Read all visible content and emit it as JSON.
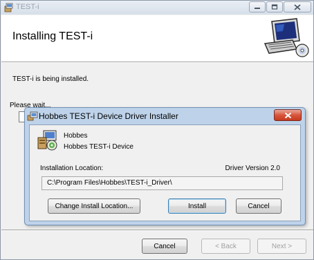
{
  "outer_window": {
    "title": "TEST-i",
    "heading": "Installing TEST-i",
    "status_text": "TEST-i is being installed.",
    "wait_text": "Please wait...",
    "buttons": {
      "cancel": "Cancel",
      "back": "< Back",
      "next": "Next >"
    },
    "icons": [
      "installer-icon",
      "minimize-icon",
      "maximize-icon",
      "close-icon",
      "computer-cd-icon"
    ]
  },
  "dialog": {
    "title": "Hobbes TEST-i Device Driver Installer",
    "company": "Hobbes",
    "product": "Hobbes TEST-i Device",
    "location_label": "Installation Location:",
    "driver_version": "Driver Version 2.0",
    "install_path": "C:\\Program Files\\Hobbes\\TEST-i_Driver\\",
    "buttons": {
      "change_location": "Change Install Location...",
      "install": "Install",
      "cancel": "Cancel"
    }
  },
  "colors": {
    "dialog_frame": "#bed3ea",
    "close_button": "#c53a1f",
    "window_face": "#f0f0f0"
  }
}
